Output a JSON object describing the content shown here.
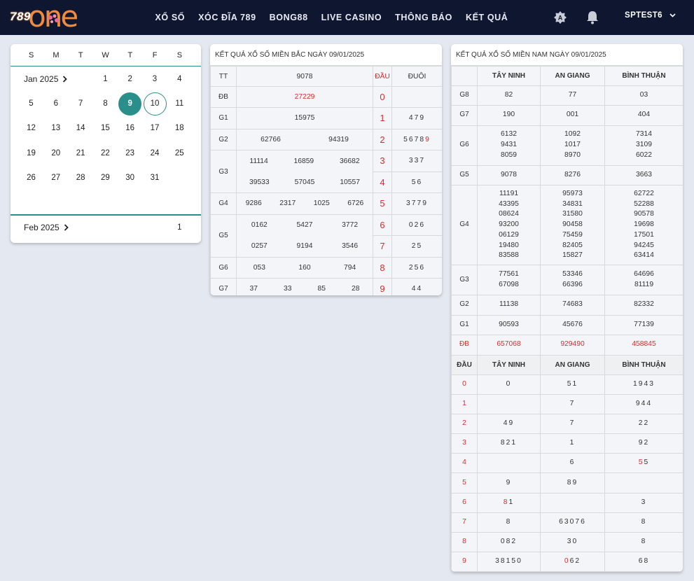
{
  "header": {
    "logo_digits": "789",
    "logo_word": "one",
    "nav": [
      "XỔ SỐ",
      "XÓC ĐĨA 789",
      "BONG88",
      "LIVE CASINO",
      "THÔNG BÁO",
      "KẾT QUẢ"
    ],
    "username": "SPTEST6"
  },
  "calendar": {
    "weekdays": [
      "S",
      "M",
      "T",
      "W",
      "T",
      "F",
      "S"
    ],
    "month1": "Jan 2025",
    "month2": "Feb 2025",
    "jan_rows": [
      [
        "",
        "",
        "",
        "1",
        "2",
        "3",
        "4"
      ],
      [
        "5",
        "6",
        "7",
        "8",
        "9",
        "10",
        "11"
      ],
      [
        "12",
        "13",
        "14",
        "15",
        "16",
        "17",
        "18"
      ],
      [
        "19",
        "20",
        "21",
        "22",
        "23",
        "24",
        "25"
      ],
      [
        "26",
        "27",
        "28",
        "29",
        "30",
        "31",
        ""
      ]
    ],
    "feb_rows": [
      [
        "",
        "",
        "",
        "",
        "",
        "",
        "1"
      ]
    ],
    "selected": "9",
    "today": "10"
  },
  "north": {
    "title": "KẾT QUẢ XỔ SỐ MIỀN BẮC NGÀY 09/01/2025",
    "col_tt": "TT",
    "head_value": "9078",
    "col_dau": "ĐẦU",
    "col_duoi": "ĐUÔI",
    "rows": [
      {
        "label": "ĐB",
        "lines": [
          [
            "27229"
          ]
        ],
        "red": true
      },
      {
        "label": "G1",
        "lines": [
          [
            "15975"
          ]
        ]
      },
      {
        "label": "G2",
        "lines": [
          [
            "62766",
            "94319"
          ]
        ]
      },
      {
        "label": "G3",
        "lines": [
          [
            "11114",
            "16859",
            "36682"
          ],
          [
            "39533",
            "57045",
            "10557"
          ]
        ]
      },
      {
        "label": "G4",
        "lines": [
          [
            "9286",
            "2317",
            "1025",
            "6726"
          ]
        ]
      },
      {
        "label": "G5",
        "lines": [
          [
            "0162",
            "5427",
            "3772"
          ],
          [
            "0257",
            "9194",
            "3546"
          ]
        ]
      },
      {
        "label": "G6",
        "lines": [
          [
            "053",
            "160",
            "794"
          ]
        ]
      },
      {
        "label": "G7",
        "lines": [
          [
            "37",
            "33",
            "85",
            "28"
          ]
        ]
      }
    ],
    "loto": [
      {
        "d": "0",
        "t": ""
      },
      {
        "d": "1",
        "t": "479"
      },
      {
        "d": "2",
        "t": "5678",
        "t_red": "9"
      },
      {
        "d": "3",
        "t": "337"
      },
      {
        "d": "4",
        "t": "56"
      },
      {
        "d": "5",
        "t": "3779"
      },
      {
        "d": "6",
        "t": "026"
      },
      {
        "d": "7",
        "t": "25"
      },
      {
        "d": "8",
        "t": "256"
      },
      {
        "d": "9",
        "t": "44"
      }
    ]
  },
  "south": {
    "title": "KẾT QUẢ XỔ SỐ MIỀN NAM NGÀY 09/01/2025",
    "provinces": [
      "TÂY NINH",
      "AN GIANG",
      "BÌNH THUẬN"
    ],
    "rows": [
      {
        "label": "G8",
        "cells": [
          [
            "82"
          ],
          [
            "77"
          ],
          [
            "03"
          ]
        ]
      },
      {
        "label": "G7",
        "cells": [
          [
            "190"
          ],
          [
            "001"
          ],
          [
            "404"
          ]
        ]
      },
      {
        "label": "G6",
        "cells": [
          [
            "6132",
            "9431",
            "8059"
          ],
          [
            "1092",
            "1017",
            "8970"
          ],
          [
            "7314",
            "3109",
            "6022"
          ]
        ]
      },
      {
        "label": "G5",
        "cells": [
          [
            "9078"
          ],
          [
            "8276"
          ],
          [
            "3663"
          ]
        ]
      },
      {
        "label": "G4",
        "cells": [
          [
            "11191",
            "43395",
            "08624",
            "93200",
            "06129",
            "19480",
            "83588"
          ],
          [
            "95973",
            "34831",
            "31580",
            "90458",
            "75459",
            "82405",
            "15827"
          ],
          [
            "62722",
            "52288",
            "90578",
            "19698",
            "17501",
            "94245",
            "63414"
          ]
        ]
      },
      {
        "label": "G3",
        "cells": [
          [
            "77561",
            "67098"
          ],
          [
            "53346",
            "66396"
          ],
          [
            "64696",
            "81119"
          ]
        ]
      },
      {
        "label": "G2",
        "cells": [
          [
            "11138"
          ],
          [
            "74683"
          ],
          [
            "82332"
          ]
        ]
      },
      {
        "label": "G1",
        "cells": [
          [
            "90593"
          ],
          [
            "45676"
          ],
          [
            "77139"
          ]
        ]
      },
      {
        "label": "ĐB",
        "cells": [
          [
            "657068"
          ],
          [
            "929490"
          ],
          [
            "458845"
          ]
        ],
        "red": true
      }
    ],
    "col_dau": "ĐẦU",
    "loto": [
      {
        "d": "0",
        "c": [
          {
            "t": "0"
          },
          {
            "t": "51"
          },
          {
            "t": "1943"
          }
        ]
      },
      {
        "d": "1",
        "c": [
          {
            "t": ""
          },
          {
            "t": "7"
          },
          {
            "t": "944"
          }
        ]
      },
      {
        "d": "2",
        "c": [
          {
            "t": "49"
          },
          {
            "t": "7"
          },
          {
            "t": "22"
          }
        ]
      },
      {
        "d": "3",
        "c": [
          {
            "t": "821"
          },
          {
            "t": "1"
          },
          {
            "t": "92"
          }
        ]
      },
      {
        "d": "4",
        "c": [
          {
            "t": ""
          },
          {
            "t": "6"
          },
          {
            "t": "5",
            "r": "5",
            "rfirst": true
          }
        ]
      },
      {
        "d": "5",
        "c": [
          {
            "t": "9"
          },
          {
            "t": "89"
          },
          {
            "t": ""
          }
        ]
      },
      {
        "d": "6",
        "c": [
          {
            "t": "1",
            "r": "8",
            "rfirst": true
          },
          {
            "t": ""
          },
          {
            "t": "3"
          }
        ]
      },
      {
        "d": "7",
        "c": [
          {
            "t": "8"
          },
          {
            "t": "63076"
          },
          {
            "t": "8"
          }
        ]
      },
      {
        "d": "8",
        "c": [
          {
            "t": "082"
          },
          {
            "t": "30"
          },
          {
            "t": "8"
          }
        ]
      },
      {
        "d": "9",
        "c": [
          {
            "t": "38150"
          },
          {
            "t": "62",
            "r": "0",
            "rfirst": true
          },
          {
            "t": "68"
          }
        ]
      }
    ]
  }
}
